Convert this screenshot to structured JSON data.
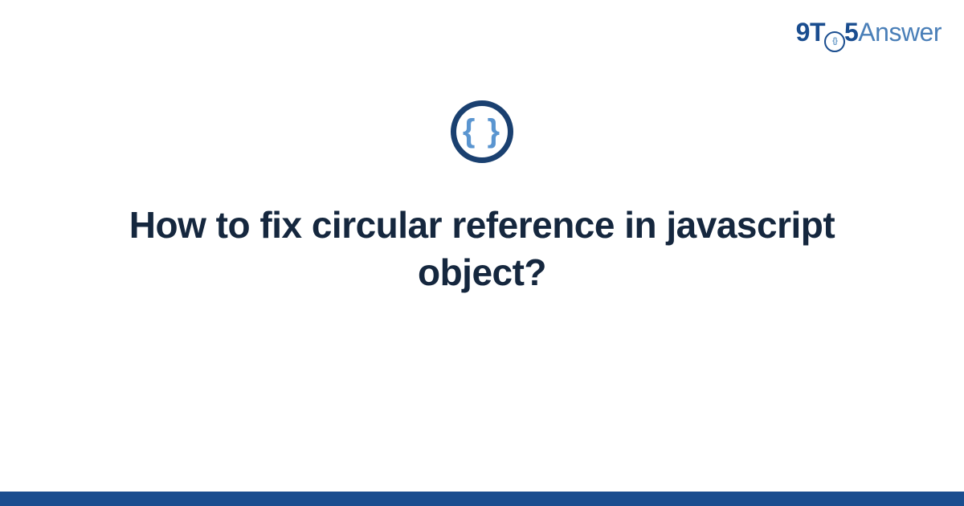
{
  "logo": {
    "prefix": "9T",
    "zero_inner": "{}",
    "mid": "5",
    "suffix": "Answer"
  },
  "category_icon": {
    "name": "code-braces-icon",
    "glyph": "{ }"
  },
  "title": "How to fix circular reference in javascript object?",
  "colors": {
    "brand_dark": "#1a4d8f",
    "brand_light": "#4a7fb8",
    "icon_ring": "#1a4070",
    "icon_braces": "#5a95d0",
    "heading": "#15273e"
  }
}
